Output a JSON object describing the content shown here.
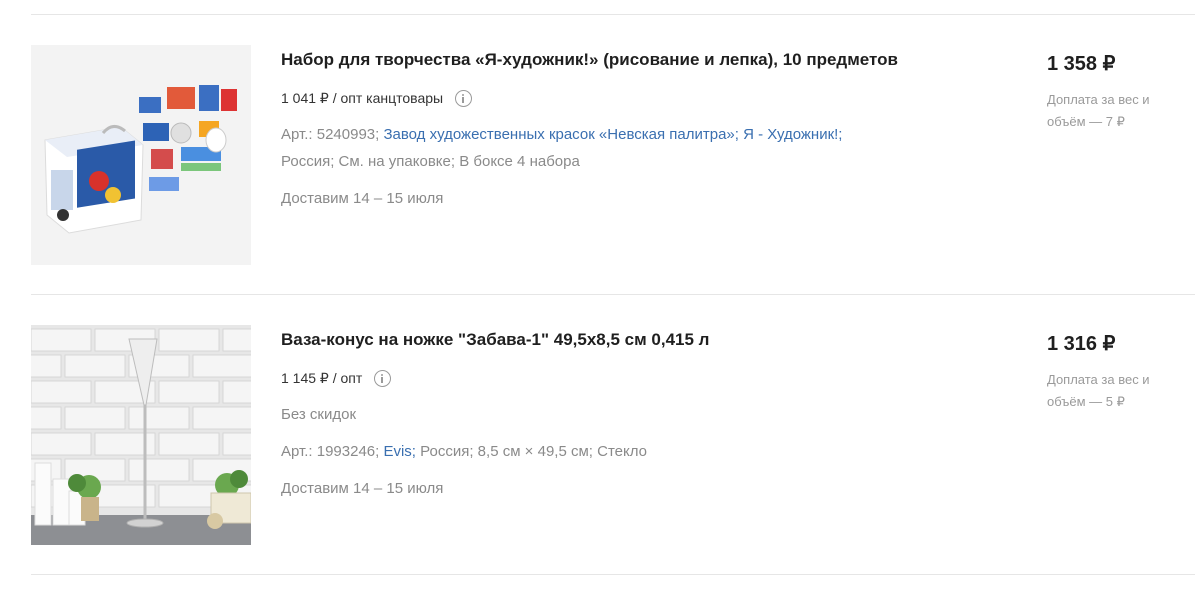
{
  "products": [
    {
      "title": "Набор для творчества «Я-художник!» (рисование и лепка), 10 предметов",
      "opt_price": "1 041 ₽ / опт канцтовары",
      "art_prefix": "Арт.: 5240993;",
      "links": [
        "Завод художественных красок «Невская палитра»;",
        "Я - Художник!;"
      ],
      "meta_tail": "Россия; См. на упаковке; В боксе 4 набора",
      "delivery": "Доставим 14 – 15 июля",
      "price": "1 358 ₽",
      "extra": "Доплата за вес и объём — 7 ₽"
    },
    {
      "title": "Ваза-конус на ножке \"Забава-1\" 49,5х8,5 см 0,415 л",
      "opt_price": "1 145 ₽ / опт",
      "discount": "Без скидок",
      "art_prefix": "Арт.: 1993246;",
      "links": [
        "Evis;"
      ],
      "meta_tail": "Россия; 8,5 см × 49,5 см; Стекло",
      "delivery": "Доставим 14 – 15 июля",
      "price": "1 316 ₽",
      "extra": "Доплата за вес и объём — 5 ₽"
    }
  ],
  "icons": [
    "info-icon"
  ]
}
